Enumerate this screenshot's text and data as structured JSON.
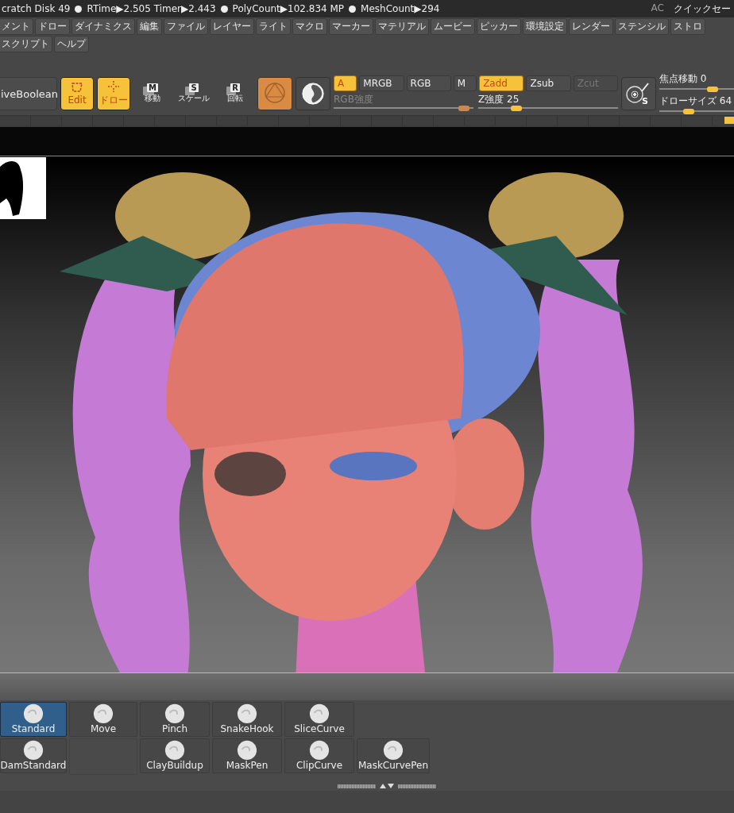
{
  "status_bar": {
    "items": [
      {
        "text": "cratch Disk 49",
        "dot": true
      },
      {
        "text": "RTime▶2.505 Timer▶2.443",
        "dot": true
      },
      {
        "text": "PolyCount▶102.834 MP",
        "dot": true
      },
      {
        "text": "MeshCount▶294",
        "dot": false
      }
    ],
    "right": [
      "AC",
      "クイックセー"
    ]
  },
  "menu_rows": [
    [
      "メント",
      "ドロー",
      "ダイナミクス",
      "編集",
      "ファイル",
      "レイヤー",
      "ライト",
      "マクロ",
      "マーカー",
      "マテリアル",
      "ムービー",
      "ピッカー",
      "環境設定",
      "レンダー",
      "ステンシル",
      "ストロ"
    ],
    [
      "スクリプト",
      "ヘルプ"
    ]
  ],
  "toolbar": {
    "subtool_button": "iveBoolean",
    "modes": [
      {
        "kind": "edit",
        "label": "Edit",
        "selected": true
      },
      {
        "kind": "draw",
        "label": "ドロー",
        "selected": true
      }
    ],
    "transforms": [
      {
        "key": "M",
        "label": "移動"
      },
      {
        "key": "S",
        "label": "スケール"
      },
      {
        "key": "R",
        "label": "回転"
      }
    ],
    "rgb_buttons": [
      {
        "label": "A",
        "selected": true
      },
      {
        "label": "MRGB",
        "selected": false
      },
      {
        "label": "RGB",
        "selected": false
      },
      {
        "label": "M",
        "selected": false
      }
    ],
    "z_buttons": [
      {
        "label": "Zadd",
        "selected": true,
        "disabled": false
      },
      {
        "label": "Zsub",
        "selected": false,
        "disabled": false
      },
      {
        "label": "Zcut",
        "selected": false,
        "disabled": true
      }
    ],
    "sliders": [
      {
        "label": "RGB強度",
        "level": 0.97,
        "disabled": true
      },
      {
        "label": "Z強度 25",
        "level": 0.25,
        "disabled": false
      }
    ],
    "right_sliders": [
      {
        "label": "焦点移動 0",
        "level": 0.75
      },
      {
        "label": "ドローサイズ 64",
        "level": 0.38
      }
    ],
    "stroke_letter": "S"
  },
  "brushes": [
    [
      {
        "kind": "brush",
        "name": "Standard",
        "selected": true
      },
      {
        "kind": "brush",
        "name": "Move",
        "selected": false
      },
      {
        "kind": "brush",
        "name": "Pinch",
        "selected": false
      },
      {
        "kind": "brush",
        "name": "SnakeHook",
        "selected": false
      },
      {
        "kind": "brush",
        "name": "SliceCurve",
        "selected": false
      }
    ],
    [
      {
        "kind": "brush",
        "name": "DamStandard",
        "selected": false
      },
      {
        "kind": "empty"
      },
      {
        "kind": "brush",
        "name": "ClayBuildup",
        "selected": false
      },
      {
        "kind": "brush",
        "name": "MaskPen",
        "selected": false
      },
      {
        "kind": "brush",
        "name": "ClipCurve",
        "selected": false
      },
      {
        "kind": "brush",
        "name": "MaskCurvePen",
        "selected": false
      }
    ]
  ]
}
